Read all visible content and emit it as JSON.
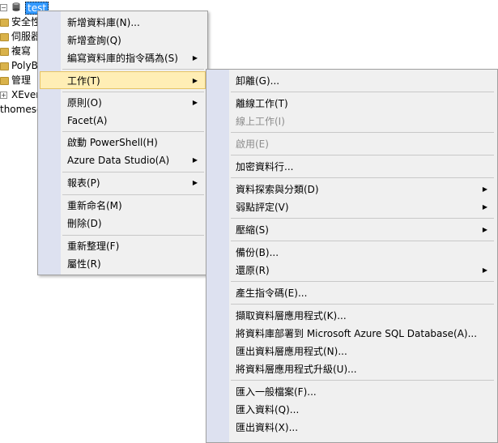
{
  "tree": {
    "db_label": "test",
    "items": [
      "安全性",
      "伺服器",
      "複寫",
      "PolyB",
      "管理",
      "XEven",
      "thomese"
    ]
  },
  "context_menu": {
    "items": [
      {
        "label": "新增資料庫(N)..."
      },
      {
        "label": "新增查詢(Q)"
      },
      {
        "label": "編寫資料庫的指令碼為(S)"
      },
      {
        "label": "工作(T)"
      },
      {
        "label": "原則(O)"
      },
      {
        "label": "Facet(A)"
      },
      {
        "label": "啟動 PowerShell(H)"
      },
      {
        "label": "Azure Data Studio(A)"
      },
      {
        "label": "報表(P)"
      },
      {
        "label": "重新命名(M)"
      },
      {
        "label": "刪除(D)"
      },
      {
        "label": "重新整理(F)"
      },
      {
        "label": "屬性(R)"
      }
    ]
  },
  "tasks_submenu": {
    "items": [
      {
        "label": "卸離(G)..."
      },
      {
        "label": "離線工作(T)"
      },
      {
        "label": "線上工作(I)"
      },
      {
        "label": "啟用(E)"
      },
      {
        "label": "加密資料行..."
      },
      {
        "label": "資料探索與分類(D)"
      },
      {
        "label": "弱點評定(V)"
      },
      {
        "label": "壓縮(S)"
      },
      {
        "label": "備份(B)..."
      },
      {
        "label": "還原(R)"
      },
      {
        "label": "產生指令碼(E)..."
      },
      {
        "label": "擷取資料層應用程式(K)..."
      },
      {
        "label": "將資料庫部署到 Microsoft Azure SQL Database(A)..."
      },
      {
        "label": "匯出資料層應用程式(N)..."
      },
      {
        "label": "將資料層應用程式升級(U)..."
      },
      {
        "label": "匯入一般檔案(F)..."
      },
      {
        "label": "匯入資料(Q)..."
      },
      {
        "label": "匯出資料(X)..."
      }
    ]
  },
  "colors": {
    "highlight": "#ffeeb5",
    "gutter": "#dde1f0",
    "selection": "#3399ff",
    "disabled_text": "#8d8d8d"
  }
}
